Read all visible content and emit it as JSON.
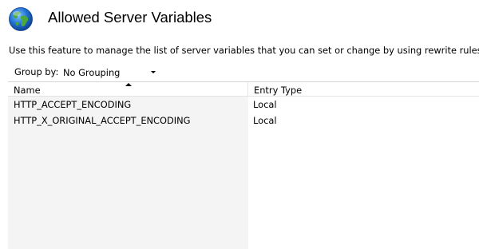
{
  "header": {
    "title": "Allowed Server Variables",
    "icon": "globe-icon"
  },
  "description": "Use this feature to manage the list of server variables that you can set or change by using rewrite rules.",
  "toolbar": {
    "group_by_label": "Group by:",
    "group_by_value": "No Grouping"
  },
  "grid": {
    "columns": [
      "Name",
      "Entry Type"
    ],
    "sort": {
      "column": "Name",
      "direction": "ascending"
    },
    "rows": [
      {
        "name": "HTTP_ACCEPT_ENCODING",
        "entry_type": "Local"
      },
      {
        "name": "HTTP_X_ORIGINAL_ACCEPT_ENCODING",
        "entry_type": "Local"
      }
    ]
  },
  "colors": {
    "name_column_background": "#f4f4f4",
    "globe_ocean": "#1f6fd0",
    "globe_land": "#4ca83a"
  }
}
